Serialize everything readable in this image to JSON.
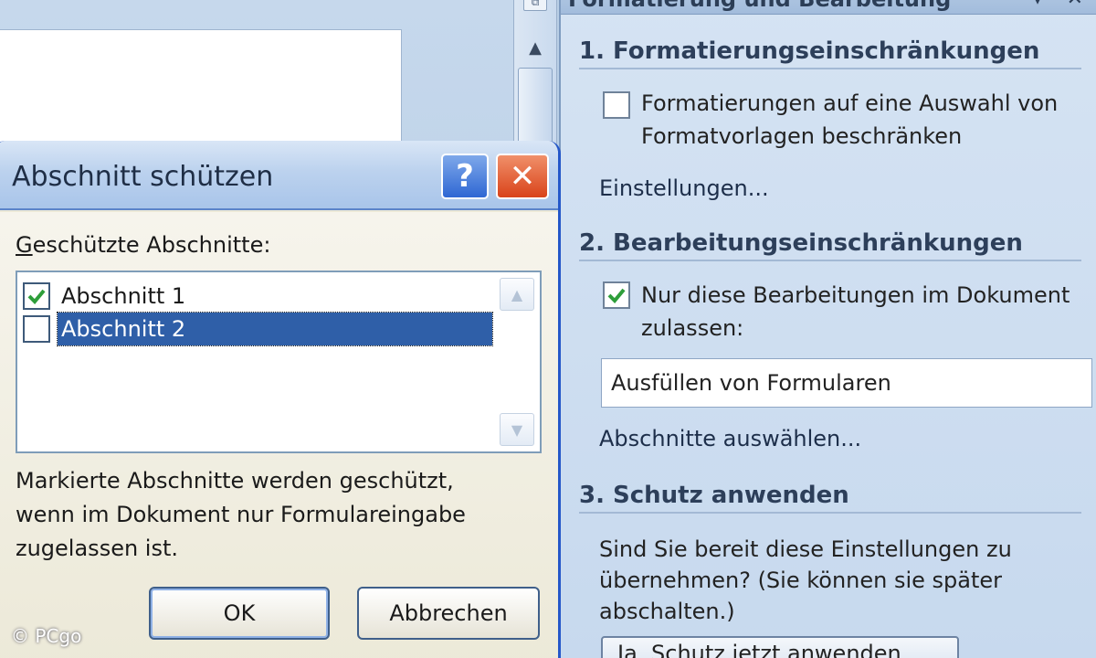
{
  "task_pane": {
    "header_title": "Formatierung und Bearbeitung",
    "header_buttons": [
      "▾",
      "✕"
    ],
    "section1": {
      "title": "1. Formatierungseinschränkungen",
      "checkbox_label_line1": "Formatierungen auf eine Auswahl von",
      "checkbox_label_line2": "Formatvorlagen beschränken",
      "checked": false,
      "settings_link": "Einstellungen..."
    },
    "section2": {
      "title": "2. Bearbeitungseinschränkungen",
      "checkbox_label_line1": "Nur diese Bearbeitungen im Dokument",
      "checkbox_label_line2": "zulassen:",
      "checked": true,
      "select_value": "Ausfüllen von Formularen",
      "sections_link": "Abschnitte auswählen..."
    },
    "section3": {
      "title": "3. Schutz anwenden",
      "text_line1": "Sind Sie bereit diese Einstellungen zu",
      "text_line2": "übernehmen? (Sie können sie später",
      "text_line3": "abschalten.)",
      "apply_button": "Ja, Schutz jetzt anwenden"
    }
  },
  "dialog": {
    "title": "Abschnitt schützen",
    "help_label": "?",
    "close_label": "✕",
    "list_label_first": "G",
    "list_label_rest": "eschützte Abschnitte:",
    "items": [
      {
        "label": "Abschnitt 1",
        "checked": true
      },
      {
        "label": "Abschnitt 2",
        "checked": false,
        "selected": true
      }
    ],
    "info_line1": "Markierte Abschnitte werden geschützt,",
    "info_line2": "wenn im Dokument nur Formulareingabe",
    "info_line3": "zugelassen ist.",
    "ok_label": "OK",
    "cancel_label": "Abbrechen"
  },
  "copyright": "© PCgo",
  "colors": {
    "dialog_border": "#2457c9",
    "selection": "#2f5fa8",
    "checkmark": "#2e9e3a",
    "close_button": "#d9431a"
  }
}
